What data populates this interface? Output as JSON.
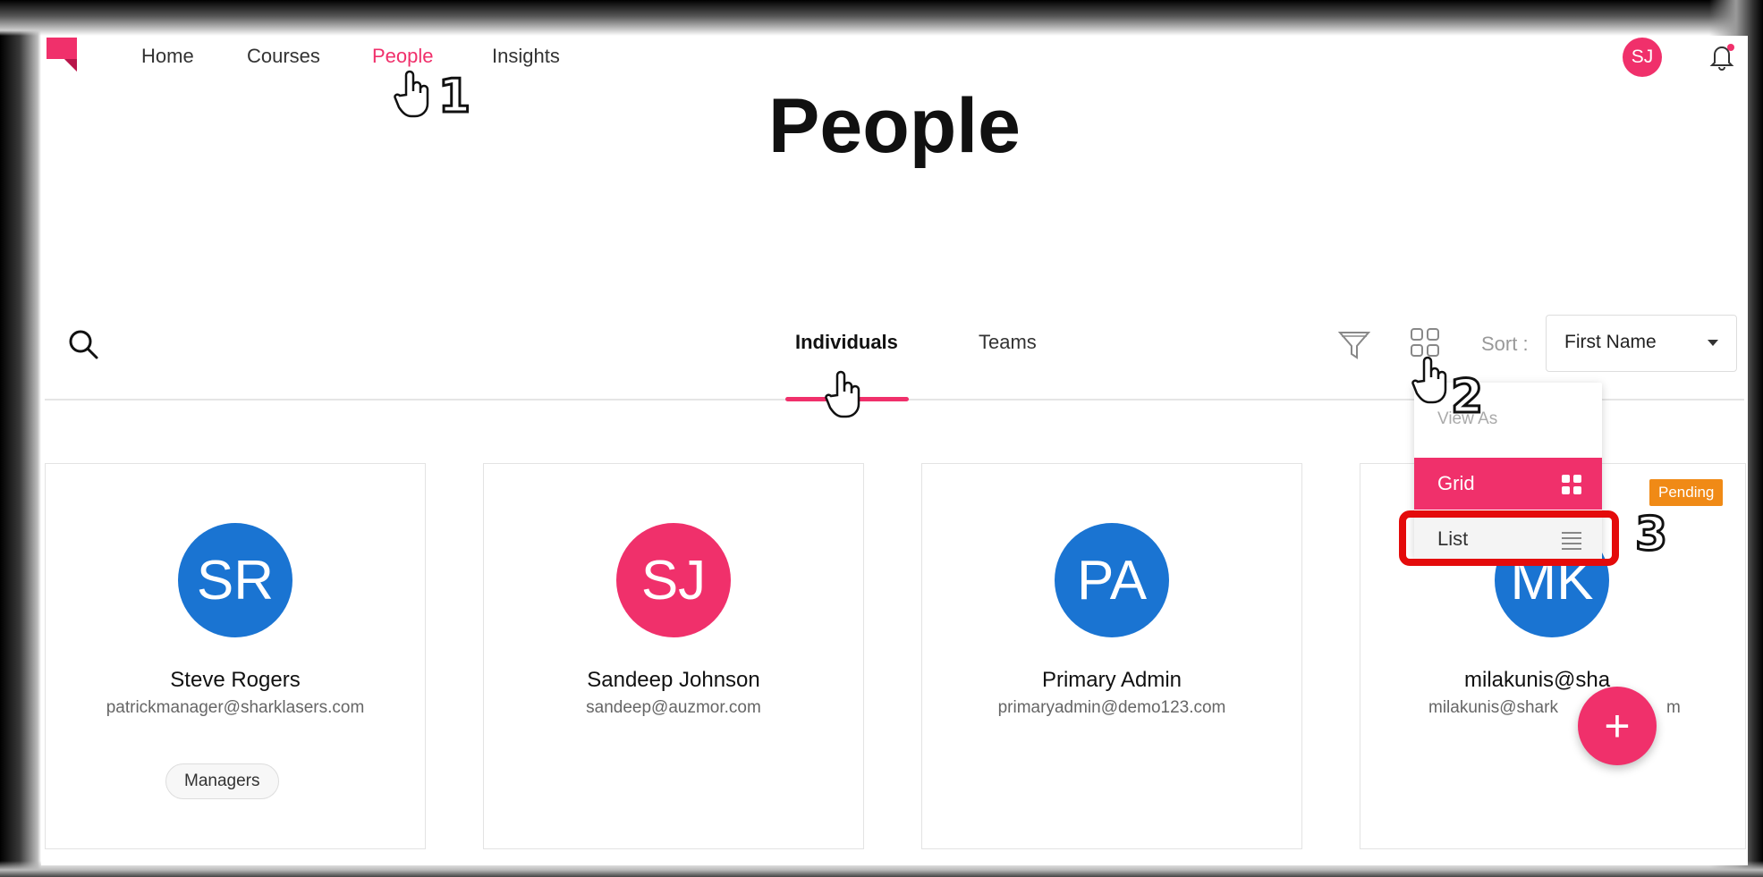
{
  "nav": {
    "items": [
      "Home",
      "Courses",
      "People",
      "Insights"
    ],
    "active": "People",
    "user_initials": "SJ"
  },
  "page": {
    "title": "People"
  },
  "toolbar": {
    "tabs": [
      "Individuals",
      "Teams"
    ],
    "active_tab": "Individuals",
    "sort_label": "Sort :",
    "sort_value": "First Name"
  },
  "view_menu": {
    "header": "View As",
    "options": [
      {
        "label": "Grid",
        "selected": true
      },
      {
        "label": "List",
        "selected": false
      }
    ]
  },
  "cards": [
    {
      "initials": "SR",
      "name": "Steve Rogers",
      "email": "patrickmanager@sharklasers.com",
      "tag": "Managers",
      "color": "#1a74d2"
    },
    {
      "initials": "SJ",
      "name": "Sandeep Johnson",
      "email": "sandeep@auzmor.com",
      "tag": "",
      "color": "#f0306b"
    },
    {
      "initials": "PA",
      "name": "Primary Admin",
      "email": "primaryadmin@demo123.com",
      "tag": "",
      "color": "#1a74d2"
    },
    {
      "initials": "MK",
      "name": "milakunis@sha",
      "email": "milakunis@shark",
      "email_tail": "m",
      "tag": "",
      "color": "#1a74d2",
      "status": "Pending"
    }
  ],
  "fab_label": "+",
  "annotations": [
    "1",
    "2",
    "3"
  ],
  "colors": {
    "accent": "#f0306b",
    "avatar_blue": "#1a74d2",
    "pending": "#f08a16",
    "highlight": "#e40b0b"
  }
}
